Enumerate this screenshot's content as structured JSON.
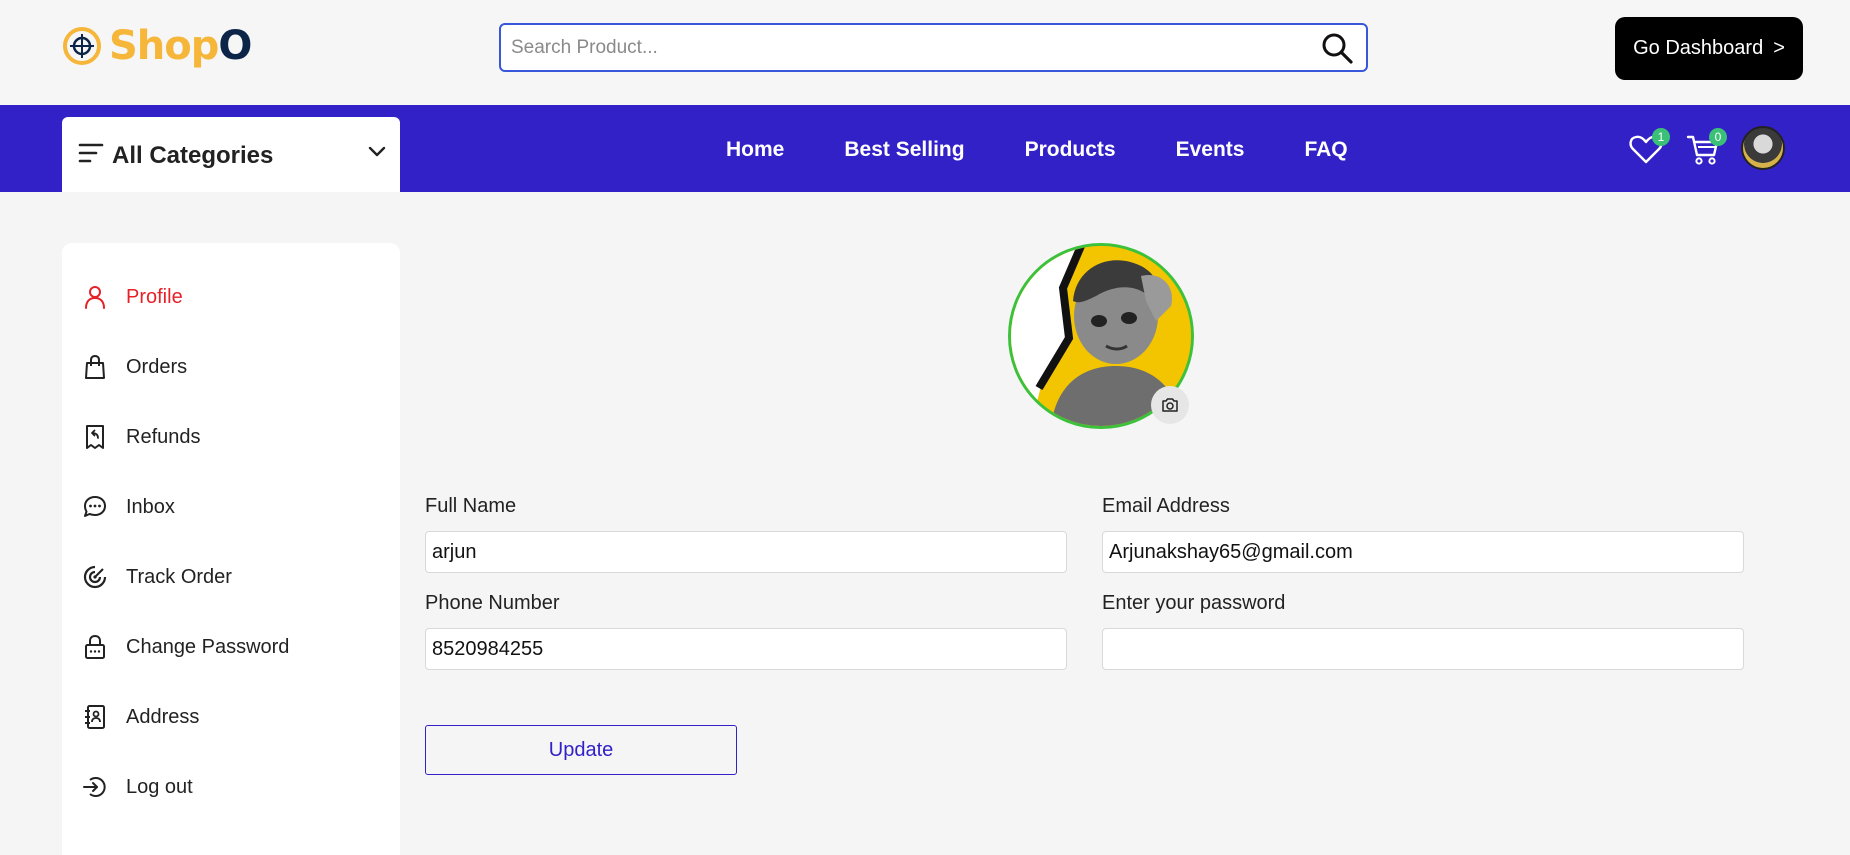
{
  "brand": {
    "name_part1": "Shop",
    "name_part2": "O",
    "color_accent": "#f5b63a",
    "color_dark": "#0b2447"
  },
  "search": {
    "placeholder": "Search Product...",
    "value": ""
  },
  "header": {
    "dashboard_label": "Go Dashboard",
    "dashboard_chevron": ">"
  },
  "nav": {
    "categories_label": "All Categories",
    "links": [
      "Home",
      "Best Selling",
      "Products",
      "Events",
      "FAQ"
    ],
    "wishlist_count": "1",
    "cart_count": "0",
    "bar_color": "#3321c8"
  },
  "sidebar": {
    "items": [
      {
        "label": "Profile",
        "icon": "person-icon",
        "active": true
      },
      {
        "label": "Orders",
        "icon": "shopping-bag-icon"
      },
      {
        "label": "Refunds",
        "icon": "receipt-refund-icon"
      },
      {
        "label": "Inbox",
        "icon": "chat-icon"
      },
      {
        "label": "Track Order",
        "icon": "track-icon"
      },
      {
        "label": "Change Password",
        "icon": "lock-icon"
      },
      {
        "label": "Address",
        "icon": "address-book-icon"
      },
      {
        "label": "Log out",
        "icon": "logout-icon"
      }
    ],
    "active_color": "#e52228"
  },
  "profile_form": {
    "full_name_label": "Full Name",
    "full_name_value": "arjun",
    "email_label": "Email Address",
    "email_value": "Arjunakshay65@gmail.com",
    "phone_label": "Phone Number",
    "phone_value": "8520984255",
    "password_label": "Enter your password",
    "password_value": "",
    "update_label": "Update"
  }
}
